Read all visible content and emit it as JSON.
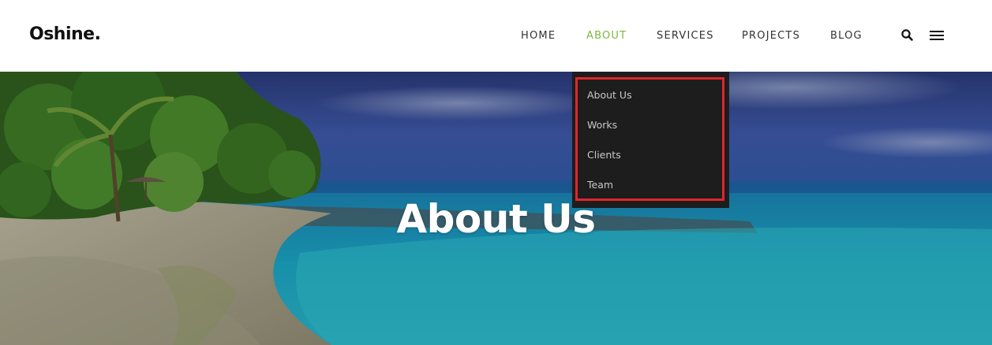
{
  "brand": {
    "logo_text": "Oshine."
  },
  "nav": {
    "items": [
      {
        "label": "HOME"
      },
      {
        "label": "ABOUT",
        "active": true
      },
      {
        "label": "SERVICES"
      },
      {
        "label": "PROJECTS"
      },
      {
        "label": "BLOG"
      }
    ],
    "active_color": "#7cb83d"
  },
  "header_icons": [
    "search-icon",
    "hamburger-menu-icon"
  ],
  "dropdown": {
    "items": [
      {
        "label": "About Us"
      },
      {
        "label": "Works"
      },
      {
        "label": "Clients"
      },
      {
        "label": "Team"
      }
    ],
    "background": "#1d1d1d",
    "highlight_color": "#e0262c"
  },
  "hero": {
    "title": "About Us"
  }
}
